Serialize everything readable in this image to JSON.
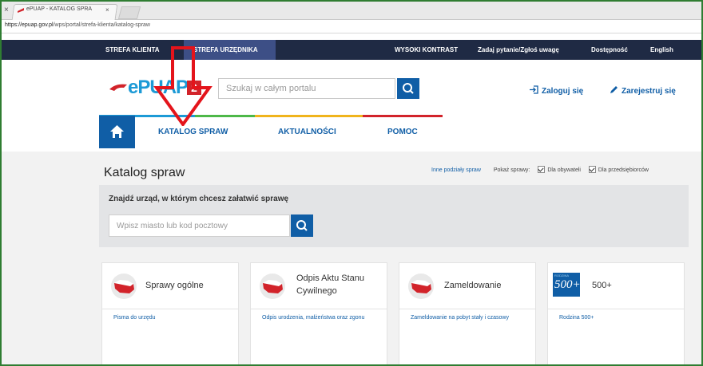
{
  "browser": {
    "tab_title": "ePUAP - KATALOG SPRA",
    "tab_close": "×",
    "left_x": "×",
    "url_host": "https://epuap.gov.pl",
    "url_path": "/wps/portal/strefa-klienta/katalog-spraw"
  },
  "topnav": {
    "strefa_klienta": "STREFA KLIENTA",
    "strefa_urzednika": "STREFA URZĘDNIKA",
    "wysoki_kontrast": "WYSOKI KONTRAST",
    "zadaj_pytanie": "Zadaj pytanie/Zgłoś uwagę",
    "dostepnosc": "Dostępność",
    "english": "English"
  },
  "header": {
    "logo_text": "ePUAP",
    "logo_number": "2",
    "search_placeholder": "Szukaj w całym portalu",
    "login": "Zaloguj się",
    "register": "Zarejestruj się"
  },
  "menu": {
    "katalog": "KATALOG SPRAW",
    "aktualnosci": "AKTUALNOŚCI",
    "pomoc": "POMOC"
  },
  "catalog": {
    "title": "Katalog spraw",
    "inne_podzialy": "Inne podziały spraw",
    "pokaz_sprawy": "Pokaż sprawy:",
    "dla_obywateli": "Dla obywateli",
    "dla_przedsiebiorcow": "Dla przedsiębiorców",
    "finder_title": "Znajdź urząd, w którym chcesz załatwić sprawę",
    "finder_placeholder": "Wpisz miasto lub kod pocztowy"
  },
  "cards": [
    {
      "title": "Sprawy ogólne",
      "link": "Pisma do urzędu"
    },
    {
      "title_line1": "Odpis Aktu Stanu",
      "title_line2": "Cywilnego",
      "link": "Odpis urodzenia, małżeństwa oraz zgonu"
    },
    {
      "title": "Zameldowanie",
      "link": "Zameldowanie na pobyt stały i czasowy"
    },
    {
      "title": "500+",
      "badge_small": "RODZINA",
      "badge_big": "500+",
      "link": "Rodzina 500+"
    }
  ],
  "colors": {
    "navy": "#1f2a44",
    "blue": "#105ea6",
    "epuap_blue": "#1c9ad6",
    "red": "#d2232a",
    "highlight_arrow": "#e4141b"
  }
}
